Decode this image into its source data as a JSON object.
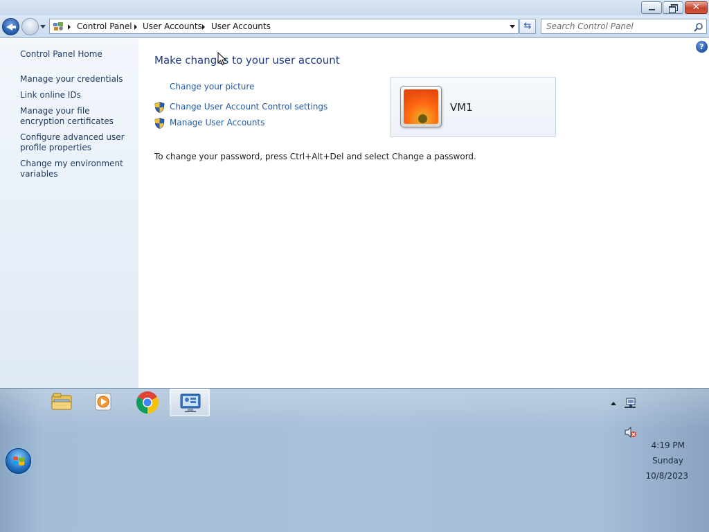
{
  "window": {
    "address": {
      "crumbs": [
        "Control Panel",
        "User Accounts",
        "User Accounts"
      ]
    },
    "search": {
      "placeholder": "Search Control Panel"
    },
    "help_label": "?",
    "close_label": "✕"
  },
  "left_pane": {
    "home": "Control Panel Home",
    "links": [
      "Manage your credentials",
      "Link online IDs",
      "Manage your file encryption certificates",
      "Configure advanced user profile properties",
      "Change my environment variables"
    ]
  },
  "main": {
    "title": "Make changes to your user account",
    "tasks": [
      "Change your picture",
      "Change User Account Control settings",
      "Manage User Accounts"
    ],
    "password_note": "To change your password, press Ctrl+Alt+Del and select Change a password.",
    "account_name": "VM1"
  },
  "taskbar": {
    "apps": [
      "windows-explorer",
      "media-player",
      "google-chrome",
      "control-panel"
    ],
    "active_app": "control-panel",
    "clock": {
      "time": "4:19 PM",
      "day": "Sunday",
      "date": "10/8/2023"
    }
  },
  "colors": {
    "link": "#1e5aa8",
    "title": "#1e3a8a",
    "left_pane": "#e6eef8",
    "taskbar": "#a9c0da"
  }
}
